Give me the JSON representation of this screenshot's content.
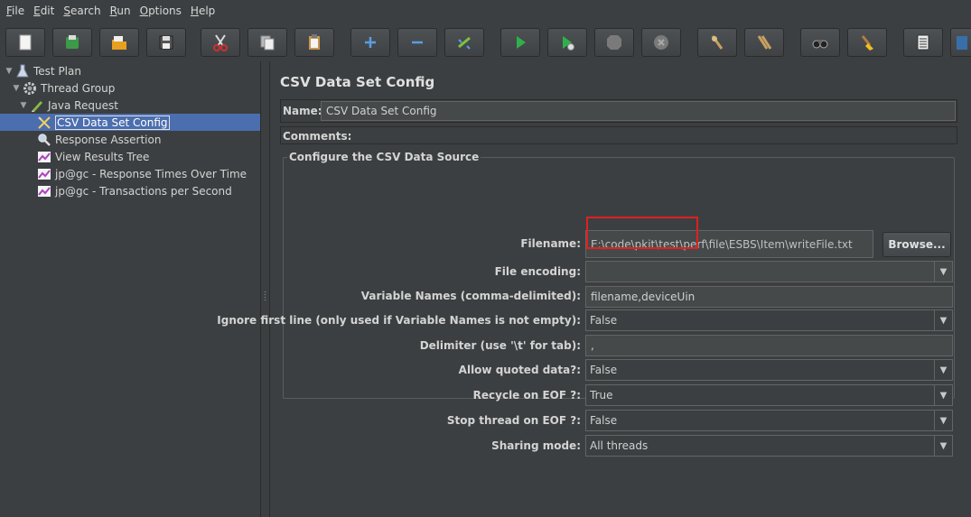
{
  "menu": [
    "File",
    "Edit",
    "Search",
    "Run",
    "Options",
    "Help"
  ],
  "toolbar": {
    "buttons": [
      {
        "name": "new-icon"
      },
      {
        "name": "templates-icon"
      },
      {
        "name": "open-icon"
      },
      {
        "name": "save-icon"
      },
      {
        "name": "cut-icon"
      },
      {
        "name": "copy-icon"
      },
      {
        "name": "paste-icon"
      },
      {
        "name": "expand-icon"
      },
      {
        "name": "collapse-icon"
      },
      {
        "name": "toggle-icon"
      },
      {
        "name": "start-icon"
      },
      {
        "name": "start-no-pause-icon"
      },
      {
        "name": "stop-icon"
      },
      {
        "name": "shutdown-icon"
      },
      {
        "name": "clear-icon"
      },
      {
        "name": "clear-all-icon"
      },
      {
        "name": "search-icon"
      },
      {
        "name": "reset-search-icon"
      },
      {
        "name": "function-helper-icon"
      },
      {
        "name": "help-icon"
      }
    ]
  },
  "tree": {
    "items": [
      {
        "label": "Test Plan",
        "icon": "test-plan-icon",
        "expanded": true
      },
      {
        "label": "Thread Group",
        "icon": "gear-icon",
        "expanded": true
      },
      {
        "label": "Java Request",
        "icon": "pen-icon",
        "expanded": true
      },
      {
        "label": "CSV Data Set Config",
        "icon": "config-icon",
        "selected": true
      },
      {
        "label": "Response Assertion",
        "icon": "assertion-icon"
      },
      {
        "label": "View Results Tree",
        "icon": "listener-icon"
      },
      {
        "label": "jp@gc - Response Times Over Time",
        "icon": "listener-icon"
      },
      {
        "label": "jp@gc - Transactions per Second",
        "icon": "listener-icon"
      }
    ]
  },
  "main": {
    "title": "CSV Data Set Config",
    "name_label": "Name:",
    "name_value": "CSV Data Set Config",
    "comments_label": "Comments:",
    "group_title": "Configure the CSV Data Source",
    "browse_label": "Browse...",
    "fields": {
      "filename": {
        "label": "Filename:",
        "value": "E:\\code\\pkit\\test\\perf\\file\\ESBS\\Item\\writeFile.txt"
      },
      "encoding": {
        "label": "File encoding:",
        "value": ""
      },
      "varnames": {
        "label": "Variable Names (comma-delimited):",
        "value": "filename,deviceUin"
      },
      "ignore": {
        "label": "Ignore first line (only used if Variable Names is not empty):",
        "value": "False"
      },
      "delimiter": {
        "label": "Delimiter (use '\\t' for tab):",
        "value": ","
      },
      "quoted": {
        "label": "Allow quoted data?:",
        "value": "False"
      },
      "recycle": {
        "label": "Recycle on EOF ?:",
        "value": "True"
      },
      "stop": {
        "label": "Stop thread on EOF ?:",
        "value": "False"
      },
      "sharing": {
        "label": "Sharing mode:",
        "value": "All threads"
      }
    }
  },
  "colors": {
    "background": "#3c3f41",
    "selection": "#4b6eaf",
    "highlight": "#e02020"
  }
}
